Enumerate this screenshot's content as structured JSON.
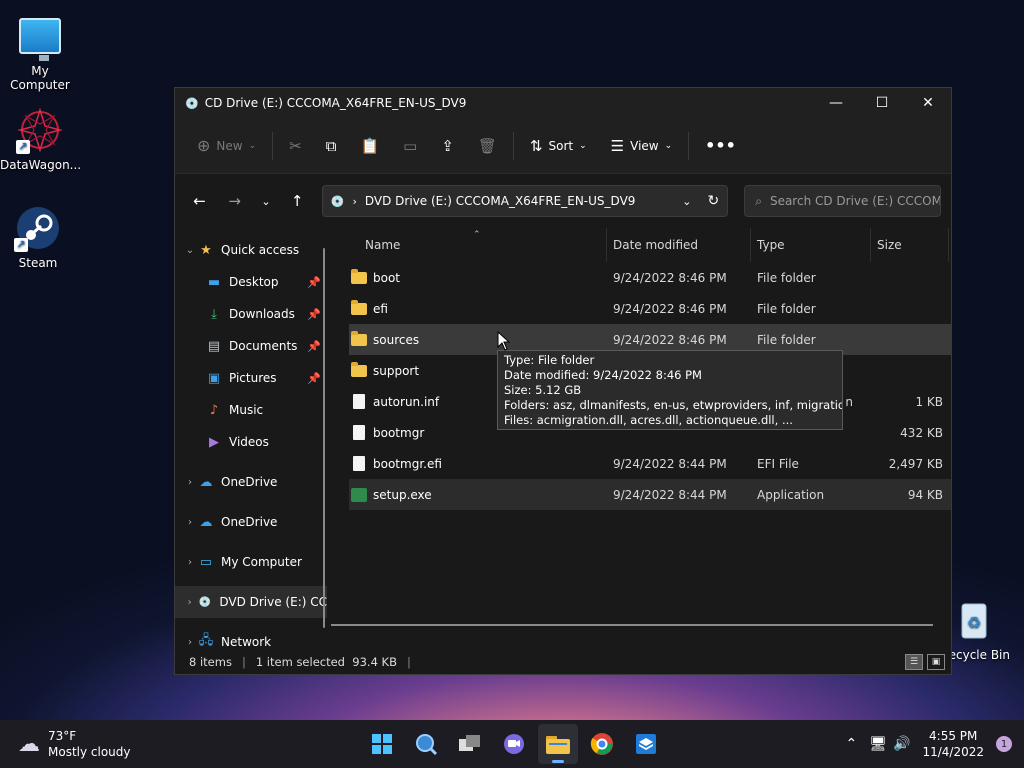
{
  "desktop": {
    "icons": [
      {
        "label": "My Computer"
      },
      {
        "label": "DataWagon..."
      },
      {
        "label": "Steam"
      },
      {
        "label": "Recycle Bin"
      }
    ]
  },
  "window": {
    "title": "CD Drive (E:) CCCOMA_X64FRE_EN-US_DV9",
    "toolbar": {
      "new_label": "New",
      "sort_label": "Sort",
      "view_label": "View"
    },
    "address": "DVD Drive (E:) CCCOMA_X64FRE_EN-US_DV9",
    "search_placeholder": "Search CD Drive (E:) CCCOM...",
    "nav": [
      {
        "label": "Quick access"
      },
      {
        "label": "Desktop"
      },
      {
        "label": "Downloads"
      },
      {
        "label": "Documents"
      },
      {
        "label": "Pictures"
      },
      {
        "label": "Music"
      },
      {
        "label": "Videos"
      },
      {
        "label": "OneDrive"
      },
      {
        "label": "OneDrive"
      },
      {
        "label": "My Computer"
      },
      {
        "label": "DVD Drive (E:) CC"
      },
      {
        "label": "Network"
      }
    ],
    "columns": {
      "name": "Name",
      "date": "Date modified",
      "type": "Type",
      "size": "Size"
    },
    "files": [
      {
        "name": "boot",
        "date": "9/24/2022 8:46 PM",
        "type": "File folder",
        "size": ""
      },
      {
        "name": "efi",
        "date": "9/24/2022 8:46 PM",
        "type": "File folder",
        "size": ""
      },
      {
        "name": "sources",
        "date": "9/24/2022 8:46 PM",
        "type": "File folder",
        "size": ""
      },
      {
        "name": "support",
        "date": "",
        "type": "",
        "size": ""
      },
      {
        "name": "autorun.inf",
        "date": "",
        "type": "n",
        "size": "1 KB"
      },
      {
        "name": "bootmgr",
        "date": "",
        "type": "",
        "size": "432 KB"
      },
      {
        "name": "bootmgr.efi",
        "date": "9/24/2022 8:44 PM",
        "type": "EFI File",
        "size": "2,497 KB"
      },
      {
        "name": "setup.exe",
        "date": "9/24/2022 8:44 PM",
        "type": "Application",
        "size": "94 KB"
      }
    ],
    "tooltip": {
      "line1": "Type: File folder",
      "line2": "Date modified: 9/24/2022 8:46 PM",
      "line3": "Size: 5.12 GB",
      "line4": "Folders: asz, dlmanifests, en-us, etwproviders, inf, migration, ...",
      "line5": "Files: acmigration.dll, acres.dll, actionqueue.dll, ..."
    },
    "status": {
      "items": "8 items",
      "selected": "1 item selected  93.4 KB"
    }
  },
  "taskbar": {
    "weather_temp": "73°F",
    "weather_desc": "Mostly cloudy",
    "time": "4:55 PM",
    "date": "11/4/2022",
    "notifications": "1"
  }
}
